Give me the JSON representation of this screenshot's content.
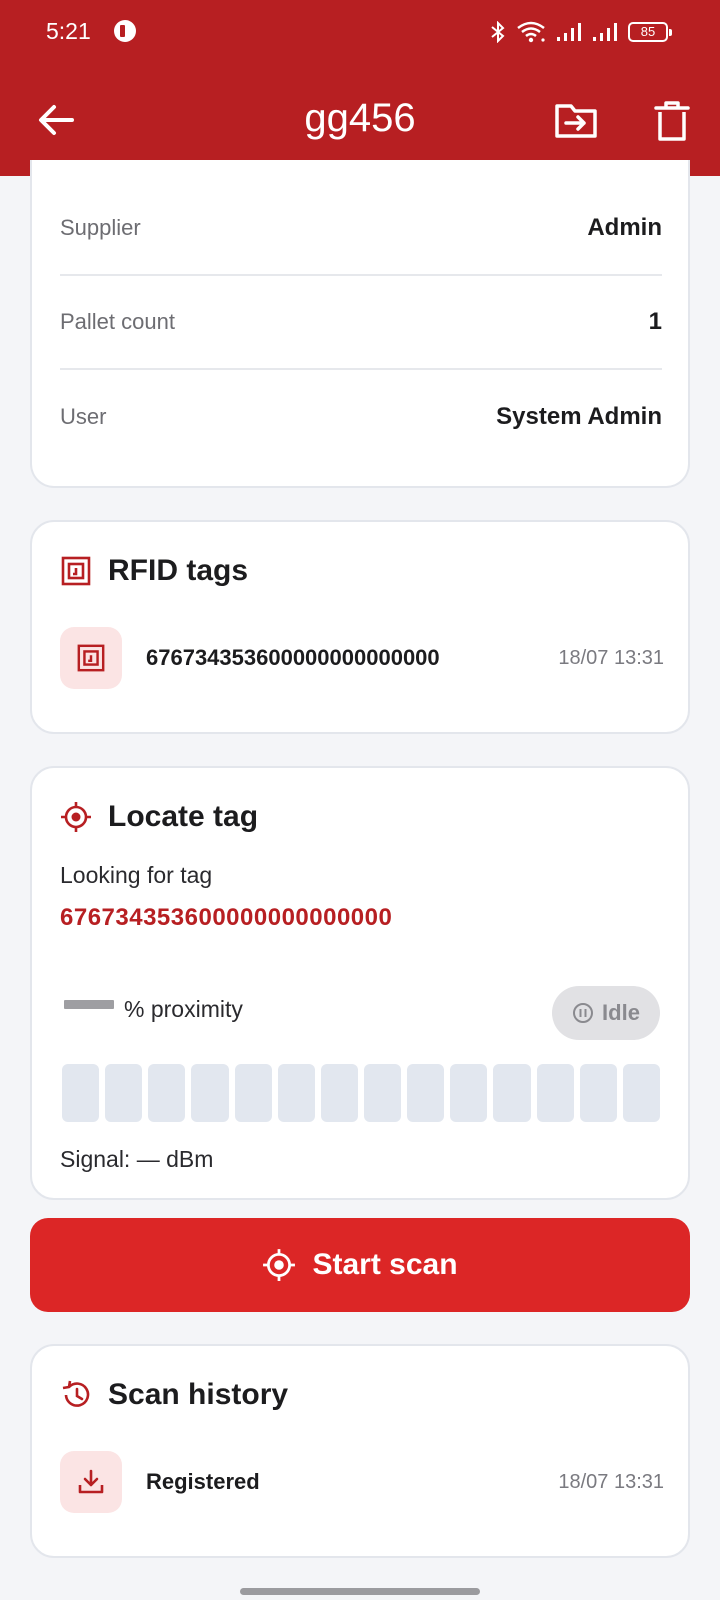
{
  "status_bar": {
    "time": "5:21",
    "battery": "85"
  },
  "app_bar": {
    "title": "gg456",
    "back_icon": "arrow-left-icon",
    "move_icon": "folder-move-icon",
    "delete_icon": "trash-icon",
    "background_color": "#b71f22"
  },
  "info": {
    "rows": [
      {
        "label": "Supplier",
        "value": "Admin"
      },
      {
        "label": "Pallet count",
        "value": "1"
      },
      {
        "label": "User",
        "value": "System Admin"
      }
    ]
  },
  "rfid": {
    "title": "RFID tags",
    "icon": "rfid-chip-icon",
    "items": [
      {
        "tag": "676734353600000000000000",
        "time": "18/07 13:31"
      }
    ]
  },
  "locate": {
    "title": "Locate tag",
    "icon": "crosshair-icon",
    "looking_label": "Looking for tag",
    "looking_tag": "676734353600000000000000",
    "proximity_label": "% proximity",
    "status": "Idle",
    "status_icon": "pause-circle-icon",
    "meter_segments": 14,
    "meter_filled": 0,
    "signal_label": "Signal: — dBm"
  },
  "scan_button": {
    "label": "Start scan",
    "icon": "crosshair-icon",
    "color": "#dc2626"
  },
  "history": {
    "title": "Scan history",
    "icon": "history-icon",
    "items": [
      {
        "label": "Registered",
        "time": "18/07 13:31",
        "icon": "download-icon"
      }
    ]
  }
}
